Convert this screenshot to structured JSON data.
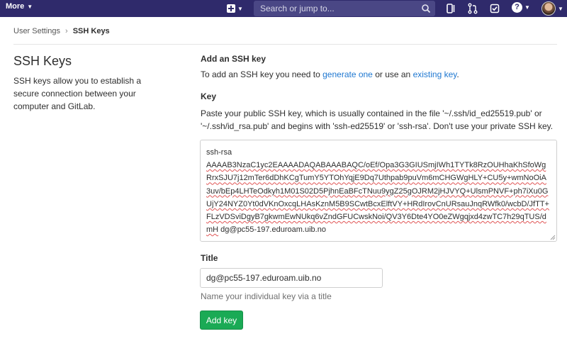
{
  "navbar": {
    "more_label": "More",
    "search_placeholder": "Search or jump to...",
    "icons": [
      "plus-square-icon",
      "search-icon",
      "issues-icon",
      "merge-request-icon",
      "todo-icon",
      "help-icon",
      "avatar"
    ]
  },
  "breadcrumb": {
    "parent": "User Settings",
    "separator": "›",
    "current": "SSH Keys"
  },
  "left": {
    "title": "SSH Keys",
    "description": "SSH keys allow you to establish a secure connection between your computer and GitLab."
  },
  "form": {
    "heading": "Add an SSH key",
    "intro_prefix": "To add an SSH key you need to ",
    "intro_link1": "generate one",
    "intro_middle": " or use an ",
    "intro_link2": "existing key",
    "intro_suffix": ".",
    "key_label": "Key",
    "key_help": "Paste your public SSH key, which is usually contained in the file '~/.ssh/id_ed25519.pub' or '~/.ssh/id_rsa.pub' and begins with 'ssh-ed25519' or 'ssh-rsa'. Don't use your private SSH key.",
    "key_type": "ssh-rsa",
    "key_body": "AAAAB3NzaC1yc2EAAAADAQABAAABAQC/oEf/Opa3G3GIUSmjIWh1TYTk8RzOUHhaKhSfoWgRrxSJU7j12mTer6dDhKCgTumY5YTOhYqjE9Dq7Uthpab9puVm6mCHGWgHLY+CU5y+wmNoOiA3uv/bEp4LHTeOdkyh1M01S02D5PjhnEaBFcTNuu9ygZ25gOJRM2jHJVYQ+UlsmPNVF+ph7iXu0GUjY24NYZ0Yt0dVKnOxcqLHAsKznM5B9SCwtBcxElftVY+HRdIrovCnURsauJnqRWfk0/wcbD/JfTT+FLzVDSviDgyB7gkwmEwNUkq6vZndGFUCwskNoi/QV3Y6Dte4YO0eZWgqjxd4zwTC7h29qTUS/dmH",
    "key_comment": " dg@pc55-197.eduroam.uib.no",
    "title_label": "Title",
    "title_value": "dg@pc55-197.eduroam.uib.no",
    "title_help": "Name your individual key via a title",
    "submit_label": "Add key"
  },
  "colors": {
    "navbar": "#2f2a6b",
    "link": "#1f78d1",
    "primary_button": "#1aaa55"
  }
}
